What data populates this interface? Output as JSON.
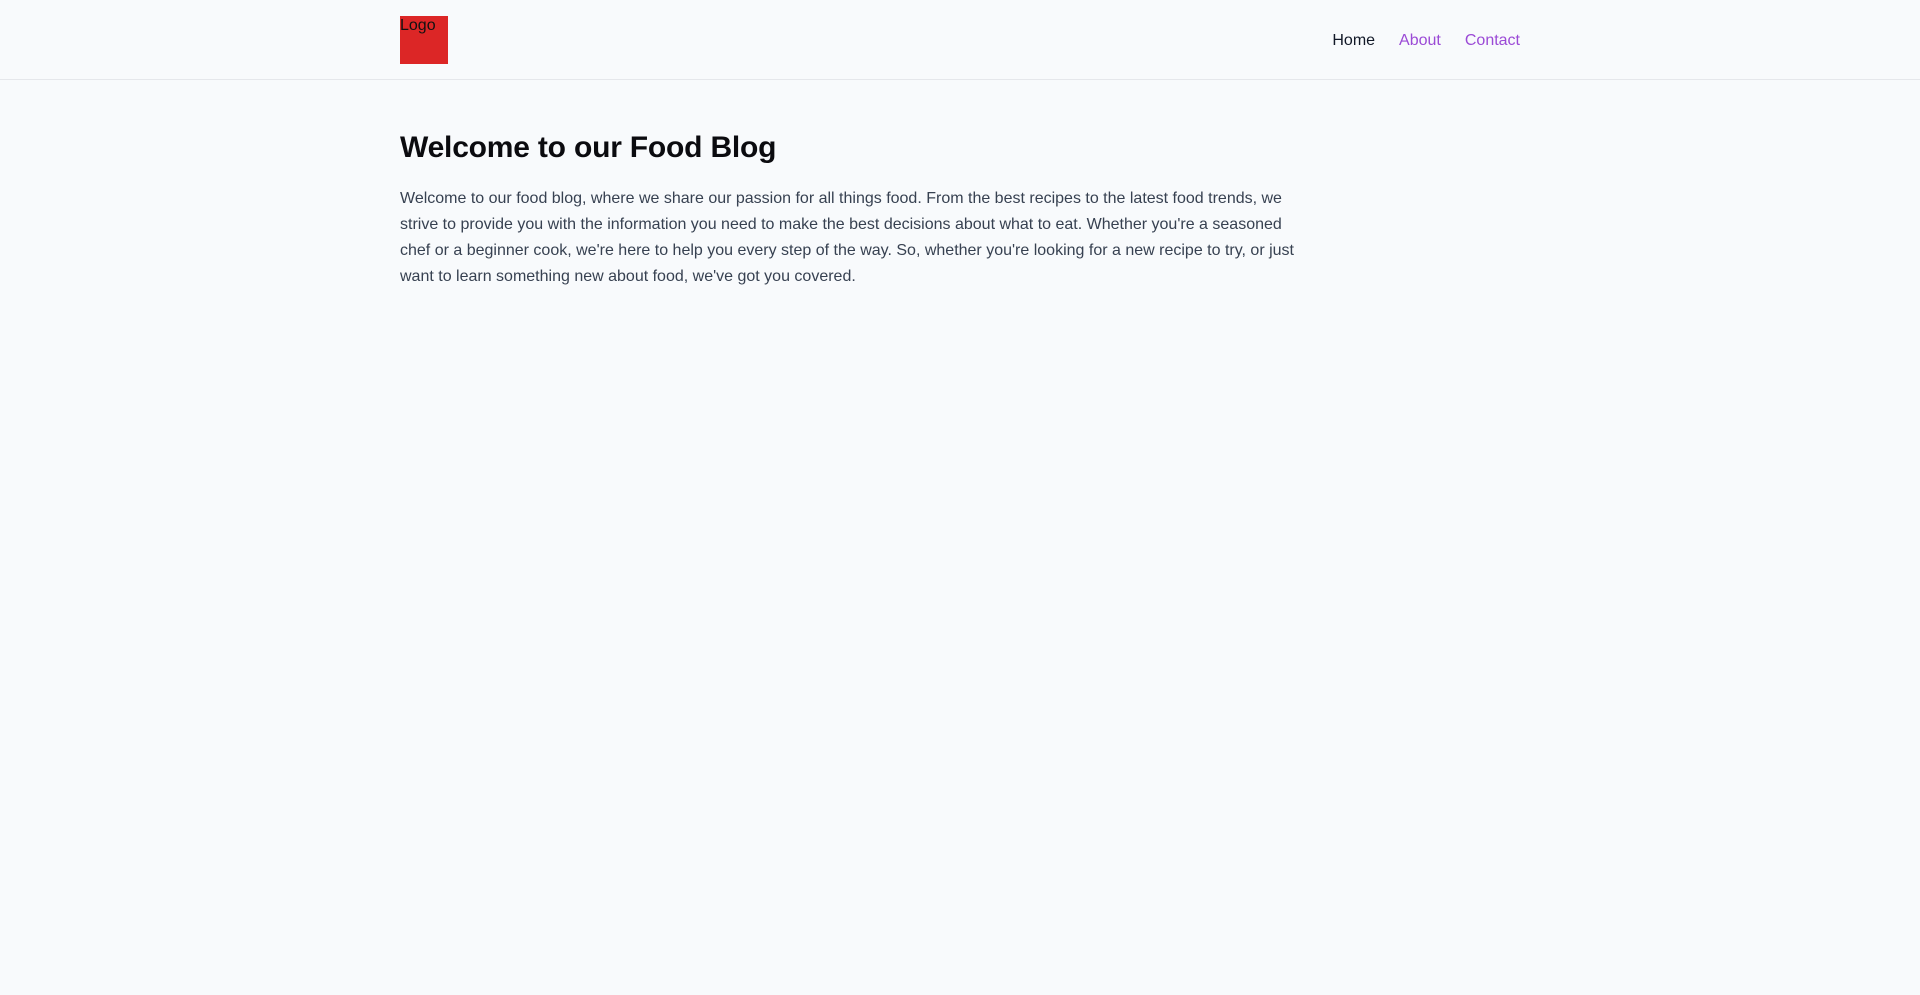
{
  "header": {
    "logo_text": "Logo",
    "logo_color": "#dc2626",
    "nav": [
      {
        "label": "Home",
        "state": "current",
        "color": "#111827"
      },
      {
        "label": "About",
        "state": "link",
        "color": "#9b4ad6"
      },
      {
        "label": "Contact",
        "state": "link",
        "color": "#9b4ad6"
      }
    ]
  },
  "main": {
    "title": "Welcome to our Food Blog",
    "body": "Welcome to our food blog, where we share our passion for all things food. From the best recipes to the latest food trends, we strive to provide you with the information you need to make the best decisions about what to eat. Whether you're a seasoned chef or a beginner cook, we're here to help you every step of the way. So, whether you're looking for a new recipe to try, or just want to learn something new about food, we've got you covered."
  }
}
